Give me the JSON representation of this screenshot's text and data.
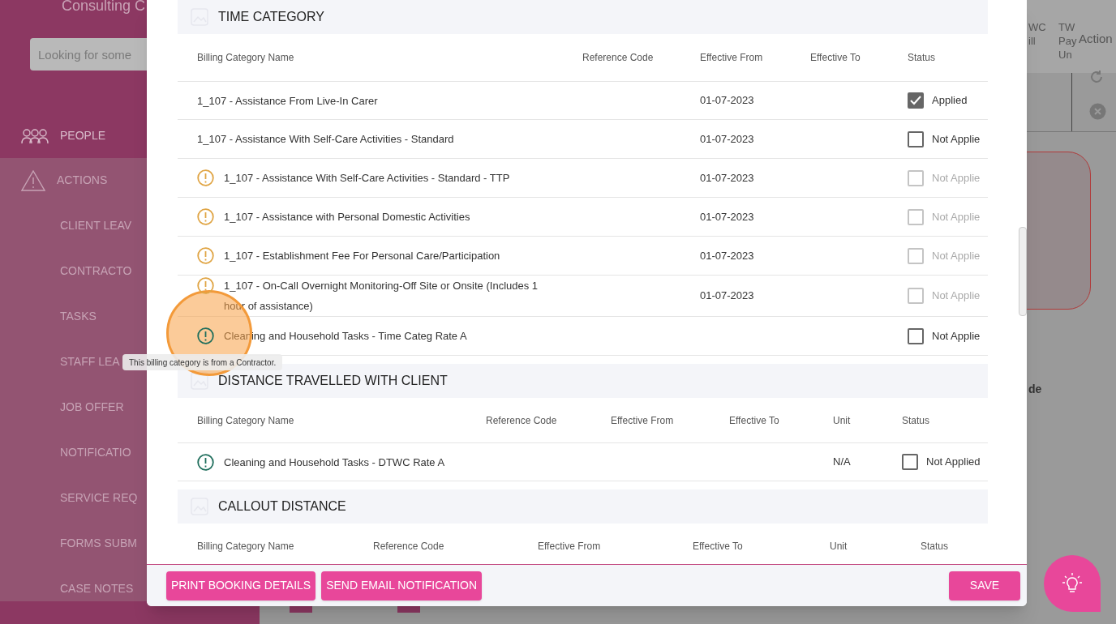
{
  "background": {
    "brand": "Consulting C",
    "search_placeholder": "Looking for some",
    "nav": [
      {
        "label": "PEOPLE",
        "selected": true
      },
      {
        "label": "ACTIONS",
        "selected": false
      },
      {
        "label": "CLIENT LEAV",
        "selected": false
      },
      {
        "label": "CONTRACTO",
        "selected": false
      },
      {
        "label": "TASKS",
        "selected": false
      },
      {
        "label": "STAFF LEA",
        "selected": false
      },
      {
        "label": "JOB OFFER",
        "selected": false
      },
      {
        "label": "NOTIFICATIO",
        "selected": false
      },
      {
        "label": "SERVICE REQ",
        "selected": false
      },
      {
        "label": "FORMS SUBM",
        "selected": false
      },
      {
        "label": "CASE NOTES",
        "selected": false
      }
    ],
    "table_headers": [
      {
        "lines": [
          "WC",
          "ill"
        ]
      },
      {
        "lines": [
          "TW",
          "Pay",
          "Un"
        ]
      },
      {
        "lines": [
          "Action"
        ]
      }
    ],
    "side_text": "de"
  },
  "modal": {
    "sections": [
      {
        "title": "TIME CATEGORY",
        "columns": [
          "Billing Category Name",
          "Reference Code",
          "Effective From",
          "Effective To",
          "Status"
        ],
        "rows": [
          {
            "cells": [
              "1_107 - Assistance From Live-In Carer",
              "",
              "01-07-2023",
              ""
            ],
            "status": "Applied",
            "checked": true,
            "disabled": false
          },
          {
            "cells": [
              "1_107 - Assistance With Self-Care Activities - Standard",
              "",
              "01-07-2023",
              ""
            ],
            "status": "Not Applie",
            "checked": false,
            "disabled": false
          },
          {
            "color": "#e0a545",
            "cells": [
              "1_107 - Assistance With Self-Care Activities - Standard - TTP",
              "",
              "01-07-2023",
              ""
            ],
            "status": "Not Applie",
            "checked": false,
            "disabled": true
          },
          {
            "color": "#e0a545",
            "cells": [
              "1_107 - Assistance with Personal Domestic Activities",
              "",
              "01-07-2023",
              ""
            ],
            "status": "Not Applie",
            "checked": false,
            "disabled": true
          },
          {
            "color": "#e0a545",
            "cells": [
              "1_107 - Establishment Fee For Personal Care/Participation",
              "",
              "01-07-2023",
              ""
            ],
            "status": "Not Applie",
            "checked": false,
            "disabled": true
          },
          {
            "color": "#e0a545",
            "cells": [
              "1_107 - On-Call Overnight Monitoring-Off Site or Onsite (Includes 1 hour of assistance)",
              "",
              "01-07-2023",
              ""
            ],
            "status": "Not Applie",
            "checked": false,
            "disabled": true
          },
          {
            "color": "#1f6e5c",
            "cells": [
              "Cleaning and Household Tasks - Time Categ Rate A",
              "",
              "",
              ""
            ],
            "status": "Not Applie",
            "checked": false,
            "disabled": false
          }
        ]
      },
      {
        "title": "DISTANCE TRAVELLED WITH CLIENT",
        "columns": [
          "Billing Category Name",
          "Reference Code",
          "Effective From",
          "Effective To",
          "Unit",
          "Status"
        ],
        "rows": [
          {
            "color": "#1f6e5c",
            "cells": [
              "Cleaning and Household Tasks - DTWC Rate A",
              "",
              "",
              "",
              "N/A"
            ],
            "status": "Not Applied",
            "checked": false,
            "disabled": false
          }
        ]
      },
      {
        "title": "CALLOUT DISTANCE",
        "columns": [
          "Billing Category Name",
          "Reference Code",
          "Effective From",
          "Effective To",
          "Unit",
          "Status"
        ]
      }
    ],
    "tooltip": "This billing category is from a Contractor.",
    "buttons": [
      "PRINT BOOKING DETAILS",
      "SEND EMAIL NOTIFICATION"
    ],
    "save": "SAVE"
  }
}
